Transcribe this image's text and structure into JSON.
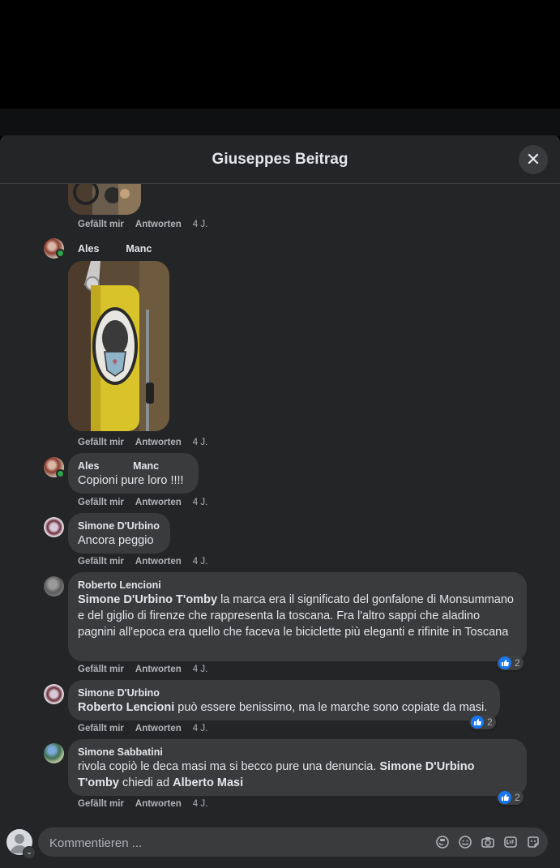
{
  "dialog": {
    "title": "Giuseppes Beitrag",
    "close_glyph": "✕"
  },
  "actions": {
    "like": "Gefällt mir",
    "reply": "Antworten",
    "time": "4 J."
  },
  "comments": [
    {
      "author_first": "Ales",
      "author_last": "Manc"
    },
    {
      "author": "Ales            Manc",
      "text": "Copioni pure loro !!!!"
    },
    {
      "author": "Simone D'Urbino",
      "text": "Ancora peggio"
    },
    {
      "author": "Roberto Lencioni",
      "mention": "Simone D'Urbino T'omby",
      "text": " la marca era il significato del gonfalone di Monsummano e del giglio di firenze che rappresenta la toscana. Fra l'altro sappi che aladino pagnini all'epoca era quello che faceva le biciclette più eleganti e rifinite in Toscana",
      "likes": "2"
    },
    {
      "author": "Simone D'Urbino",
      "mention": "Roberto Lencioni",
      "text": " può essere benissimo, ma le marche sono copiate da masi.",
      "likes": "2"
    },
    {
      "author": "Simone Sabbatini",
      "text_a": "rivola copiò le deca masi ma si becco pure una denuncia. ",
      "mention_a": "Simone D'Urbino T'omby",
      "text_b": " chiedi ad ",
      "mention_b": "Alberto Masi",
      "likes": "2"
    }
  ],
  "composer": {
    "placeholder": "Kommentieren ..."
  },
  "icons": [
    "close-icon",
    "like-icon",
    "sticker-icon",
    "emoji-icon",
    "camera-icon",
    "gif-icon",
    "avatar-sticker-icon"
  ],
  "colors": {
    "accent": "#1877f2",
    "online": "#31a24c",
    "bubble": "#3a3b3c",
    "dialog": "#242526"
  }
}
